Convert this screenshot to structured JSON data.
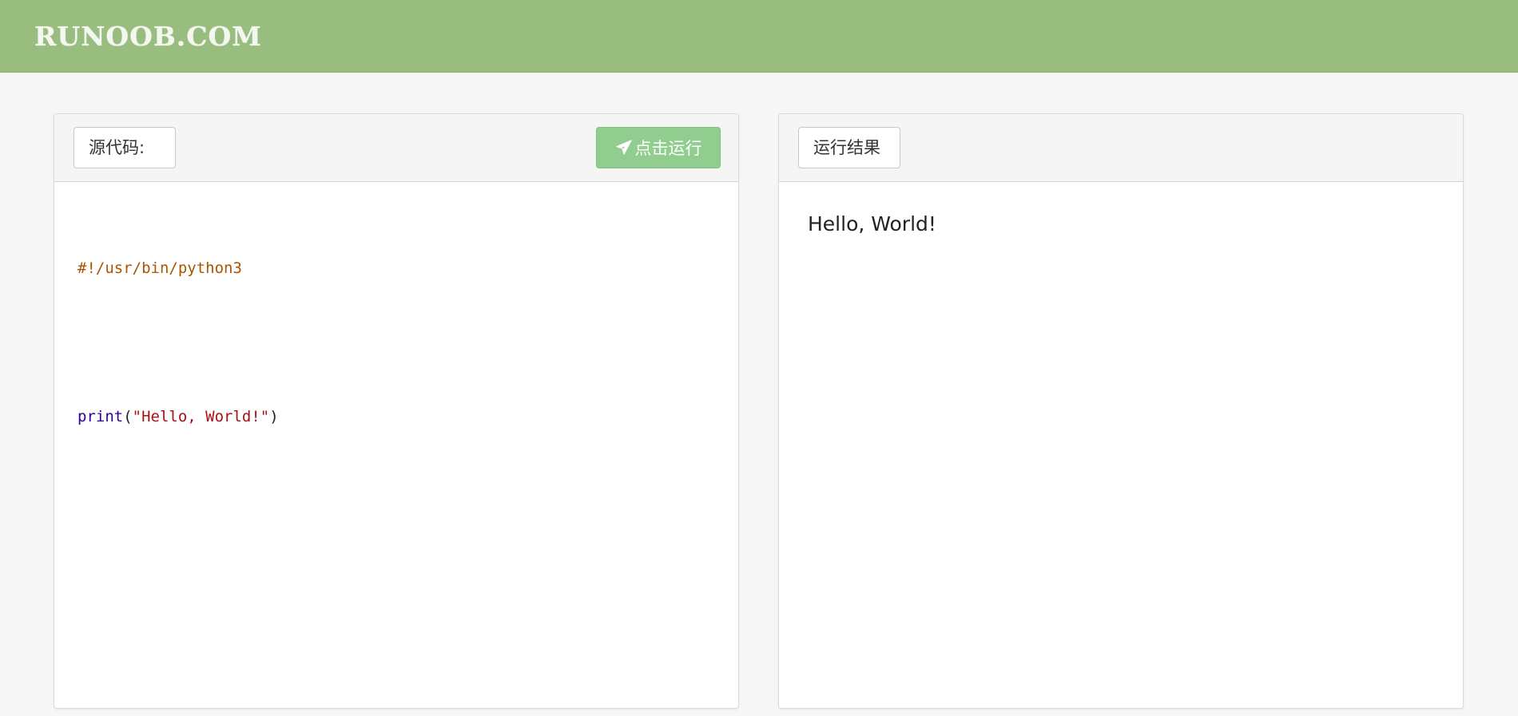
{
  "header": {
    "logo": "RUNOOB.COM",
    "bg_color": "#98bd7f"
  },
  "editor": {
    "label": "源代码:",
    "run_button": {
      "icon": "paper-plane-icon",
      "label": "点击运行",
      "color": "#90cd8f"
    },
    "code": {
      "line1": "#!/usr/bin/python3",
      "line3_builtin": "print",
      "line3_open": "(",
      "line3_string": "\"Hello, World!\"",
      "line3_close": ")"
    }
  },
  "result": {
    "label": "运行结果",
    "output": "Hello, World!"
  }
}
